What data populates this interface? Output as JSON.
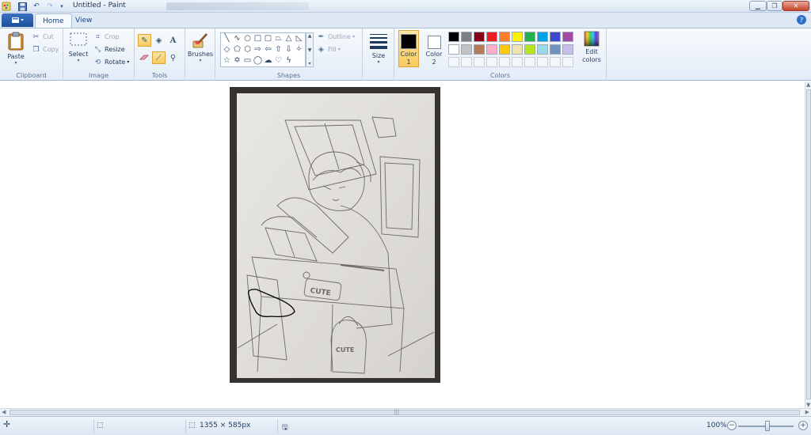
{
  "window": {
    "title": "Untitled - Paint"
  },
  "tabs": {
    "home": "Home",
    "view": "View"
  },
  "clipboard": {
    "group": "Clipboard",
    "paste": "Paste",
    "cut": "Cut",
    "copy": "Copy"
  },
  "image": {
    "group": "Image",
    "select": "Select",
    "crop": "Crop",
    "resize": "Resize",
    "rotate": "Rotate"
  },
  "tools": {
    "group": "Tools"
  },
  "brushes": {
    "label": "Brushes"
  },
  "shapes": {
    "group": "Shapes",
    "outline": "Outline",
    "fill": "Fill"
  },
  "size": {
    "label": "Size"
  },
  "colors": {
    "group": "Colors",
    "color1": "Color 1",
    "color2": "Color 2",
    "edit": "Edit colors",
    "color1_value": "#000000",
    "color2_value": "#ffffff",
    "palette": [
      "#000000",
      "#7f7f7f",
      "#880015",
      "#ed1c24",
      "#ff7f27",
      "#fff200",
      "#22b14c",
      "#00a2e8",
      "#3f48cc",
      "#a349a4",
      "#ffffff",
      "#c3c3c3",
      "#b97a57",
      "#ffaec9",
      "#ffc90e",
      "#efe4b0",
      "#b5e61d",
      "#99d9ea",
      "#7092be",
      "#c8bfe7"
    ]
  },
  "canvas": {
    "drawing": "pencil sketch of a person seated at a school desk, with a hand-drawn black outline added near the lower-left"
  },
  "status": {
    "dimensions": "1355 × 585px",
    "zoom": "100%"
  }
}
